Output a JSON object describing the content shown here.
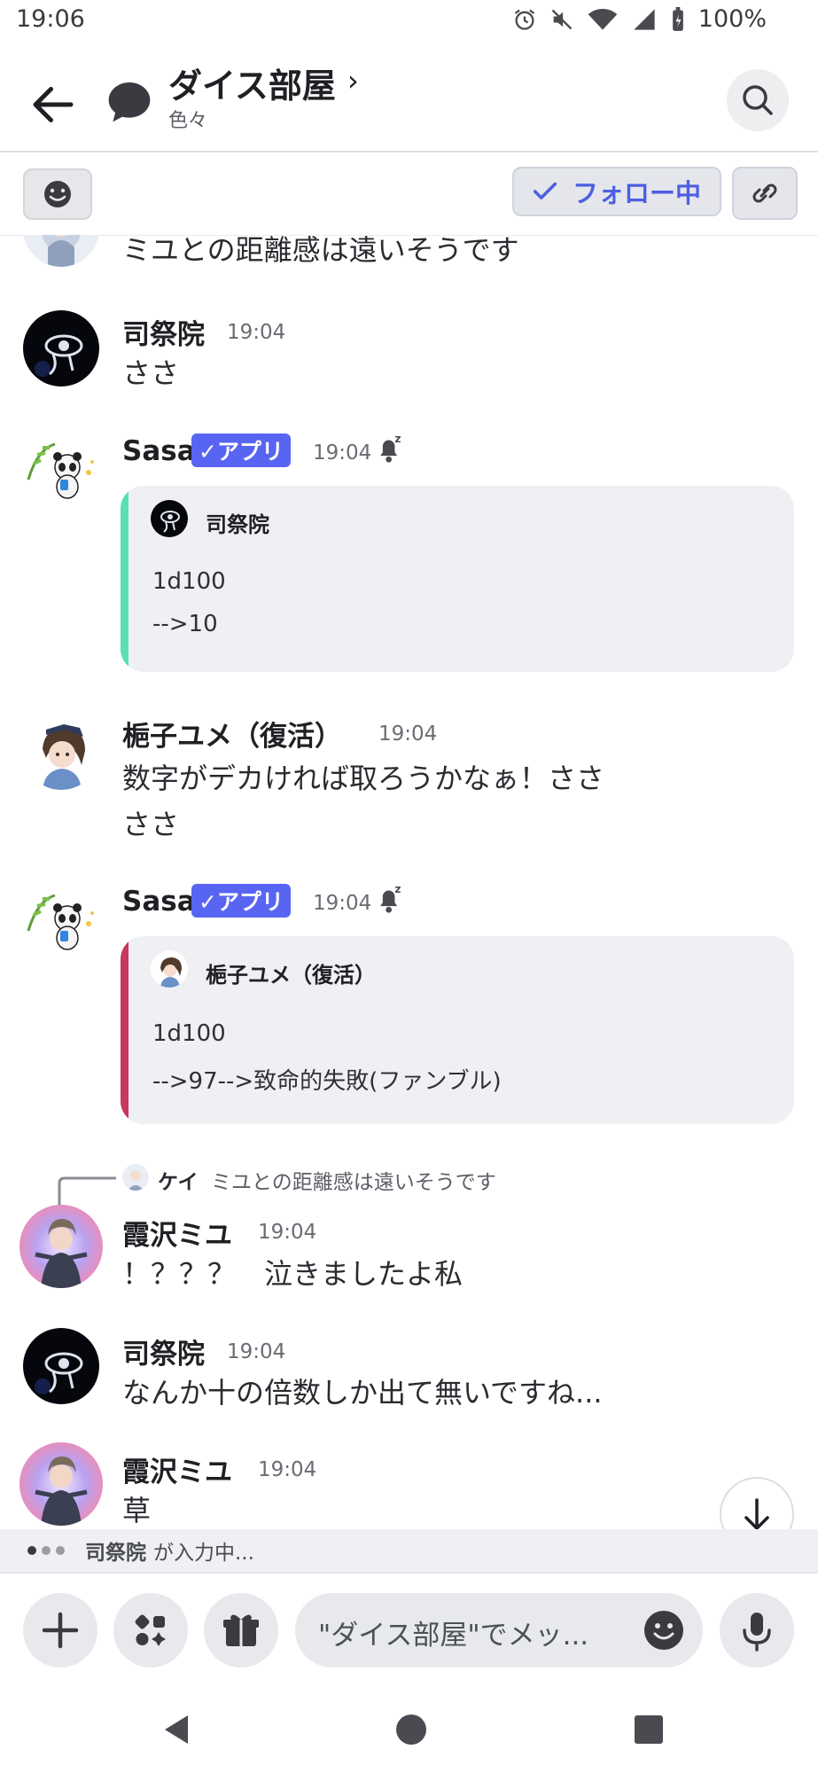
{
  "status_bar": {
    "time": "19:06",
    "battery": "100%"
  },
  "header": {
    "title": "ダイス部屋",
    "subtitle": "色々"
  },
  "subbar": {
    "follow_label": "フォロー中"
  },
  "messages": {
    "m0": {
      "text": "ミユとの距離感は遠いそうです"
    },
    "m1": {
      "name": "司祭院",
      "time": "19:04",
      "text": "ささ"
    },
    "m2": {
      "name": "Sasa",
      "badge": "✓アプリ",
      "time": "19:04",
      "embed_author": "司祭院",
      "line1": "1d100",
      "line2": "-->10"
    },
    "m3": {
      "name": "梔子ユメ（復活）",
      "time": "19:04",
      "text1": "数字がデカければ取ろうかなぁ！ささ",
      "text2": "ささ"
    },
    "m4": {
      "name": "Sasa",
      "badge": "✓アプリ",
      "time": "19:04",
      "embed_author": "梔子ユメ（復活）",
      "line1": "1d100",
      "line2": "-->97-->致命的失敗(ファンブル)"
    },
    "m5": {
      "reply_name": "ケイ",
      "reply_text": "ミユとの距離感は遠いそうです",
      "name": "霞沢ミユ",
      "time": "19:04",
      "text": "！？？？　泣きましたよ私"
    },
    "m6": {
      "name": "司祭院",
      "time": "19:04",
      "text": "なんか十の倍数しか出て無いですね..."
    },
    "m7": {
      "name": "霞沢ミユ",
      "time": "19:04",
      "text": "草"
    }
  },
  "typing": {
    "name": "司祭院",
    "suffix": "が入力中..."
  },
  "input": {
    "placeholder": "\"ダイス部屋\"でメッ..."
  },
  "colors": {
    "accent": "#5865f2",
    "embed_green": "#58e0b0",
    "embed_red": "#c8375c"
  }
}
